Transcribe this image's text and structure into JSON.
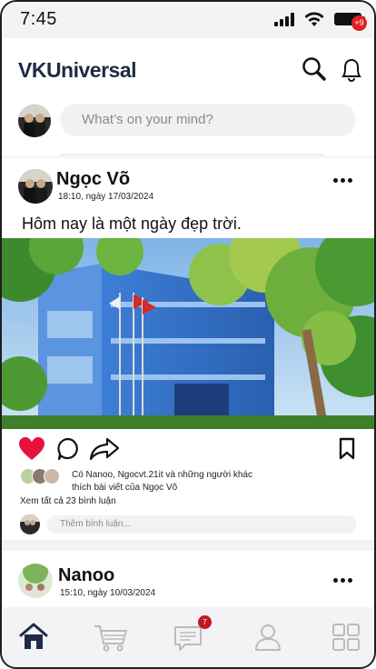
{
  "status_bar": {
    "time": "7:45"
  },
  "header": {
    "brand": "VKUniversal",
    "notification_count": "+9"
  },
  "composer": {
    "placeholder": "What’s on your mind?"
  },
  "post": {
    "author": "Ngọc Võ",
    "timestamp": "18:10, ngày 17/03/2024",
    "caption": "Hôm nay là một ngày đẹp trời.",
    "likes_text_line1": "Có Nanoo, Ngocvt.21it và những người khác",
    "likes_text_line2": "thích bài viết của Ngọc Võ",
    "view_comments": "Xem tất cả 23 bình luận",
    "comment_placeholder": "Thêm bình luận..."
  },
  "post2": {
    "author": "Nanoo",
    "timestamp": "15:10, ngày 10/03/2024"
  },
  "bottom_nav": {
    "messages_count": "7"
  },
  "icons": [
    "search-icon",
    "bell-icon",
    "more-icon",
    "heart-icon",
    "comment-icon",
    "share-icon",
    "bookmark-icon",
    "home-icon",
    "cart-icon",
    "message-icon",
    "profile-icon",
    "grid-icon"
  ],
  "colors": {
    "brand": "#1f2a44",
    "like": "#e8123f",
    "badge": "#e02020"
  }
}
